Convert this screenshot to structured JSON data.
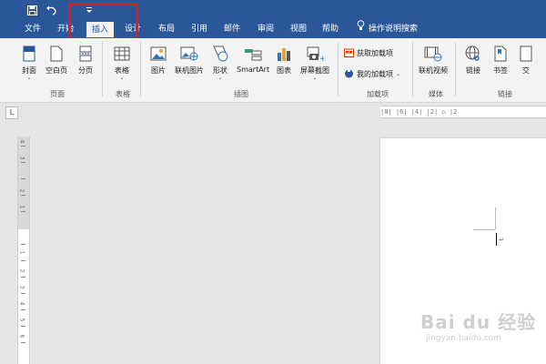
{
  "qat": {
    "save_icon": "save-icon",
    "undo_icon": "undo-icon",
    "dropdown_icon": "qat-dropdown-icon"
  },
  "tabs": [
    {
      "label": "文件"
    },
    {
      "label": "开始"
    },
    {
      "label": "插入",
      "active": true
    },
    {
      "label": "设计"
    },
    {
      "label": "布局"
    },
    {
      "label": "引用"
    },
    {
      "label": "邮件"
    },
    {
      "label": "审阅"
    },
    {
      "label": "视图"
    },
    {
      "label": "帮助"
    }
  ],
  "tell_me": "操作说明搜索",
  "ribbon": {
    "pages": {
      "cover": "封面",
      "blank": "空白页",
      "break": "分页",
      "group": "页面"
    },
    "tables": {
      "table": "表格",
      "group": "表格"
    },
    "illustrations": {
      "picture": "图片",
      "online_picture": "联机图片",
      "shapes": "形状",
      "smartart": "SmartArt",
      "chart": "图表",
      "screenshot": "屏幕截图",
      "group": "插图"
    },
    "addins": {
      "get": "获取加载项",
      "my": "我的加载项",
      "group": "加载项"
    },
    "media": {
      "video": "联机视频",
      "group": "媒体"
    },
    "links": {
      "link": "链接",
      "bookmark": "书签",
      "cross": "交",
      "group": "链接"
    }
  },
  "ruler": {
    "tab_selector": "L",
    "marks": "|8| |6| |4| |2| ⌂ |2"
  },
  "vertical_ruler_numbers": [
    "4",
    "3",
    "2",
    "1",
    "1",
    "2",
    "3",
    "4",
    "5",
    "6"
  ],
  "paragraph_mark": "↵",
  "watermark": {
    "line1": "Bai du 经验",
    "line2": "jingyan.baidu.com"
  },
  "colors": {
    "title_blue": "#2b579a",
    "highlight_red": "#e21a1a",
    "ribbon_bg": "#f3f3f3",
    "canvas": "#e6e6e6"
  }
}
